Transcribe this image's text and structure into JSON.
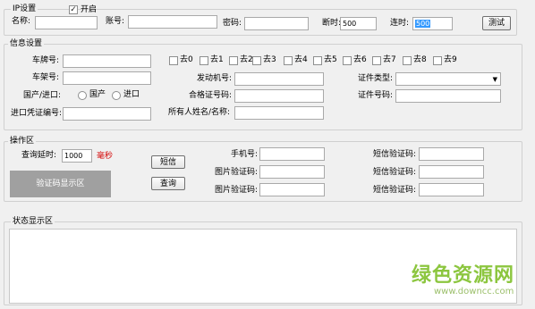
{
  "ip": {
    "title": "IP设置",
    "enable_label": "开启",
    "enable_checked": true,
    "name_label": "名称:",
    "account_label": "账号:",
    "password_label": "密码:",
    "disconnect_label": "断时:",
    "disconnect_value": "500",
    "connect_label": "连时:",
    "connect_value": "500",
    "test_button": "测试"
  },
  "info": {
    "title": "信息设置",
    "plate_label": "车牌号:",
    "vin_label": "车架号:",
    "origin_label": "国产/进口:",
    "origin_domestic": "国产",
    "origin_import": "进口",
    "import_cert_label": "进口凭证编号:",
    "skip_options": [
      "去0",
      "去1",
      "去2",
      "去3",
      "去4",
      "去5",
      "去6",
      "去7",
      "去8",
      "去9"
    ],
    "engine_label": "发动机号:",
    "conformity_label": "合格证号码:",
    "owner_label": "所有人姓名/名称:",
    "id_type_label": "证件类型:",
    "id_type_value": "",
    "id_number_label": "证件号码:"
  },
  "ops": {
    "title": "操作区",
    "query_delay_label": "查询延时:",
    "query_delay_value": "1000",
    "unit": "毫秒",
    "captcha_text": "验证码显示区",
    "sms_button": "短信",
    "query_button": "查询",
    "phone_label": "手机号:",
    "img_code_label_1": "图片验证码:",
    "img_code_label_2": "图片验证码:",
    "sms_code_label_1": "短信验证码:",
    "sms_code_label_2": "短信验证码:",
    "sms_code_label_3": "短信验证码:"
  },
  "status": {
    "title": "状态显示区"
  },
  "watermark": {
    "text": "绿色资源网",
    "url": "www.downcc.com"
  },
  "colors": {
    "unit_red": "#d40000",
    "selection_blue": "#3399ff",
    "watermark_green": "#8cc63f"
  }
}
